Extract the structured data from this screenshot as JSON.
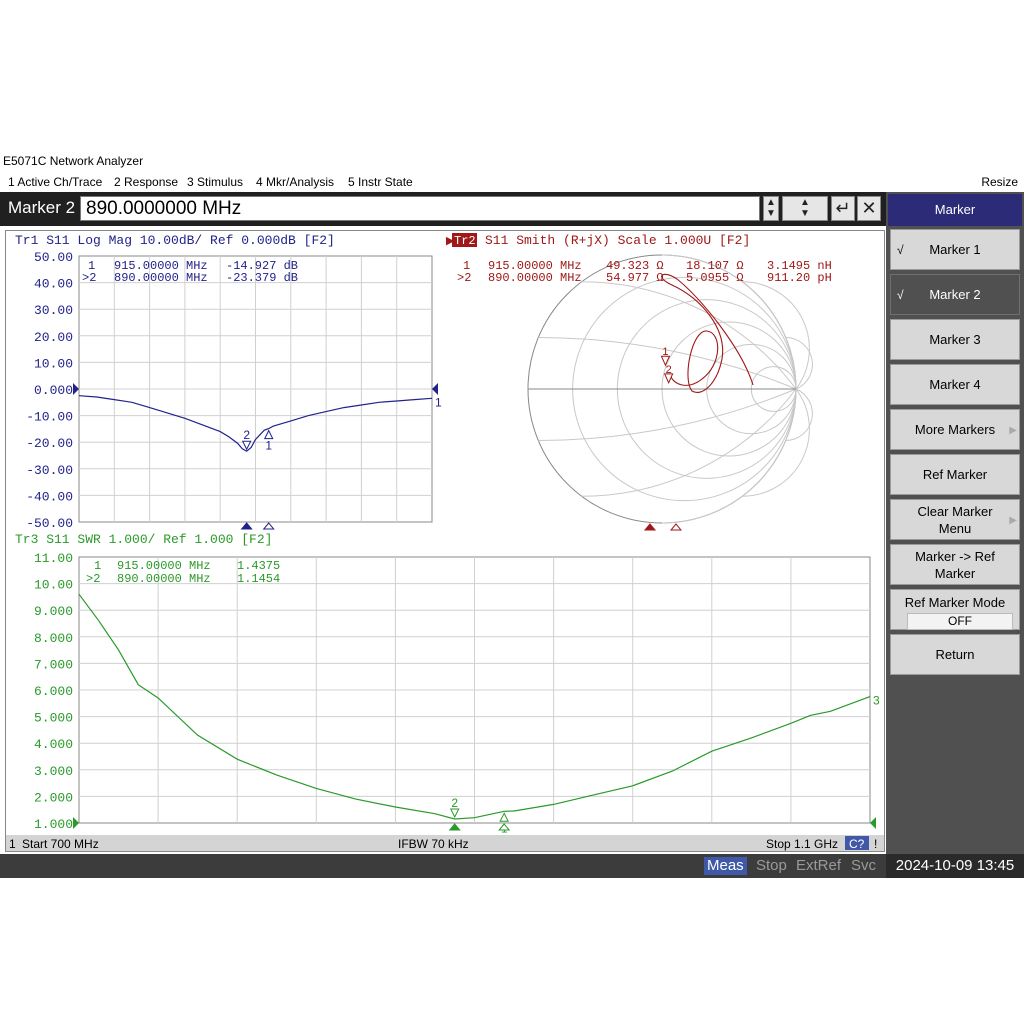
{
  "app": {
    "title": "E5071C Network Analyzer",
    "resize_label": "Resize"
  },
  "menu": [
    "1 Active Ch/Trace",
    "2 Response",
    "3 Stimulus",
    "4 Mkr/Analysis",
    "5 Instr State"
  ],
  "entry": {
    "label": "Marker 2",
    "value": "890.0000000 MHz"
  },
  "trace1": {
    "header": "Tr1 S11 Log Mag 10.00dB/ Ref 0.000dB [F2]",
    "ticks": [
      "50.00",
      "40.00",
      "30.00",
      "20.00",
      "10.00",
      "0.000",
      "-10.00",
      "-20.00",
      "-30.00",
      "-40.00",
      "-50.00"
    ],
    "markers": [
      {
        "id": "1",
        "freq": "915.00000 MHz",
        "value": "-14.927 dB"
      },
      {
        "id": ">2",
        "freq": "890.00000 MHz",
        "value": "-23.379 dB"
      }
    ],
    "color": "#22228c"
  },
  "trace2": {
    "header_tag": "Tr2",
    "header": "S11 Smith (R+jX) Scale 1.000U [F2]",
    "markers": [
      {
        "id": "1",
        "freq": "915.00000 MHz",
        "r": "49.323 Ω",
        "x": "18.107 Ω",
        "l": "3.1495 nH"
      },
      {
        "id": ">2",
        "freq": "890.00000 MHz",
        "r": "54.977 Ω",
        "x": "5.0955 Ω",
        "l": "911.20 pH"
      }
    ],
    "color": "#a01818"
  },
  "trace3": {
    "header": "Tr3 S11 SWR 1.000/ Ref 1.000 [F2]",
    "ticks": [
      "11.00",
      "10.00",
      "9.000",
      "8.000",
      "7.000",
      "6.000",
      "5.000",
      "4.000",
      "3.000",
      "2.000",
      "1.000"
    ],
    "markers": [
      {
        "id": "1",
        "freq": "915.00000 MHz",
        "value": "1.4375"
      },
      {
        "id": ">2",
        "freq": "890.00000 MHz",
        "value": "1.1454"
      }
    ],
    "color": "#2a9a2a"
  },
  "footer": {
    "channel": "1",
    "start": "Start 700 MHz",
    "ifbw": "IFBW 70 kHz",
    "stop": "Stop 1.1 GHz",
    "cal": "C?",
    "flag": "!"
  },
  "softkeys": {
    "title": "Marker",
    "items": [
      {
        "label": "Marker 1",
        "check": "√"
      },
      {
        "label": "Marker 2",
        "check": "√"
      },
      {
        "label": "Marker 3"
      },
      {
        "label": "Marker 4"
      },
      {
        "label": "More Markers"
      },
      {
        "label": "Ref Marker"
      },
      {
        "label": "Clear Marker Menu"
      },
      {
        "label": "Marker -> Ref Marker"
      },
      {
        "label": "Ref Marker Mode",
        "value": "OFF"
      },
      {
        "label": "Return"
      }
    ]
  },
  "status": [
    "Meas",
    "Stop",
    "ExtRef",
    "Svc"
  ],
  "clock": "2024-10-09 13:45",
  "chart_data": [
    {
      "type": "line",
      "title": "Tr1 S11 Log Mag 10.00dB/ Ref 0.000dB [F2]",
      "x": [
        700,
        720,
        740,
        760,
        780,
        800,
        820,
        840,
        860,
        870,
        880,
        885,
        890,
        895,
        900,
        910,
        915,
        920,
        940,
        960,
        980,
        1000,
        1020,
        1040,
        1060,
        1080,
        1100
      ],
      "series": [
        {
          "values": [
            -2.5,
            -3,
            -4,
            -5,
            -7,
            -9,
            -11,
            -13.5,
            -16,
            -18,
            -20.5,
            -22.5,
            -23.4,
            -22,
            -19,
            -15.5,
            -14.9,
            -14,
            -12,
            -10,
            -8.5,
            -7,
            -6,
            -5,
            -4.5,
            -4,
            -3.5
          ]
        }
      ],
      "ylim": [
        -50,
        50
      ]
    },
    {
      "type": "line",
      "title": "Tr3 S11 SWR 1.000/ Ref 1.000 [F2]",
      "x": [
        700,
        710,
        720,
        730,
        740,
        760,
        780,
        800,
        820,
        840,
        860,
        880,
        890,
        900,
        915,
        920,
        940,
        960,
        980,
        1000,
        1020,
        1040,
        1060,
        1070,
        1080,
        1100
      ],
      "series": [
        {
          "values": [
            9.6,
            8.6,
            7.5,
            6.2,
            5.7,
            4.3,
            3.4,
            2.8,
            2.3,
            1.9,
            1.6,
            1.35,
            1.15,
            1.2,
            1.44,
            1.45,
            1.7,
            2.05,
            2.4,
            2.95,
            3.7,
            4.2,
            4.75,
            5.05,
            5.2,
            5.75
          ]
        }
      ],
      "ylim": [
        1,
        11
      ]
    },
    {
      "type": "scatter",
      "title": "S11 Smith (R+jX) Scale 1.000U [F2]",
      "markers": [
        {
          "name": "1",
          "r_ohm": 49.323,
          "x_ohm": 18.107
        },
        {
          "name": "2",
          "r_ohm": 54.977,
          "x_ohm": 5.0955
        }
      ]
    }
  ]
}
